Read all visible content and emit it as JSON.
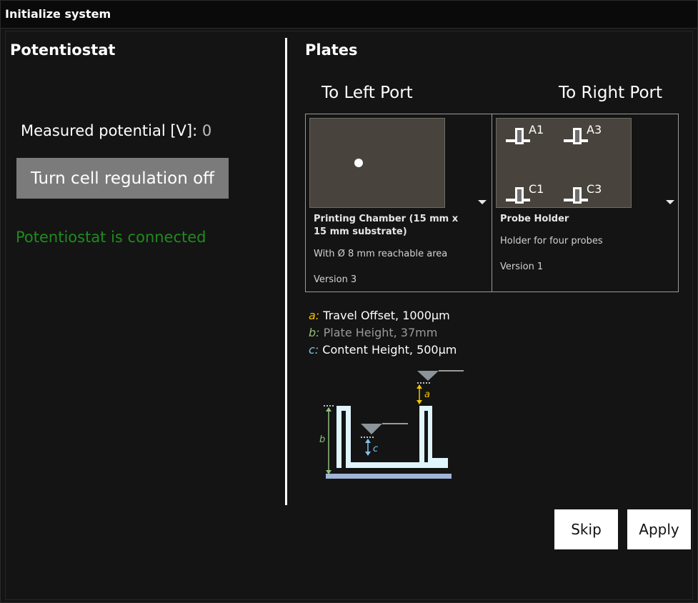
{
  "window": {
    "title": "Initialize system"
  },
  "potentiostat": {
    "heading": "Potentiostat",
    "measured_label": "Measured potential [V]: ",
    "measured_value": "0",
    "regulation_button": "Turn cell regulation off",
    "status": "Potentiostat is connected",
    "status_color": "#1e8c1e"
  },
  "plates": {
    "heading": "Plates",
    "left_port": {
      "label": "To Left Port",
      "name": "Printing Chamber (15 mm x 15 mm substrate)",
      "description": "With Ø 8 mm reachable area",
      "version": "Version 3"
    },
    "right_port": {
      "label": "To Right Port",
      "name": "Probe Holder",
      "description": "Holder for four probes",
      "version": "Version 1",
      "probes": [
        "A1",
        "A3",
        "C1",
        "C3"
      ]
    },
    "legend": [
      {
        "key": "a:",
        "text": "Travel Offset, 1000µm",
        "key_color": "#f2c200",
        "text_color": "#ffffff"
      },
      {
        "key": "b:",
        "text": "Plate Height, 37mm",
        "key_color": "#8fbf7f",
        "text_color": "#9a9a9a"
      },
      {
        "key": "c:",
        "text": "Content Height, 500µm",
        "key_color": "#7fc4ea",
        "text_color": "#ffffff"
      }
    ],
    "diagram_labels": {
      "a": "a",
      "b": "b",
      "c": "c"
    }
  },
  "buttons": {
    "skip": "Skip",
    "apply": "Apply"
  }
}
